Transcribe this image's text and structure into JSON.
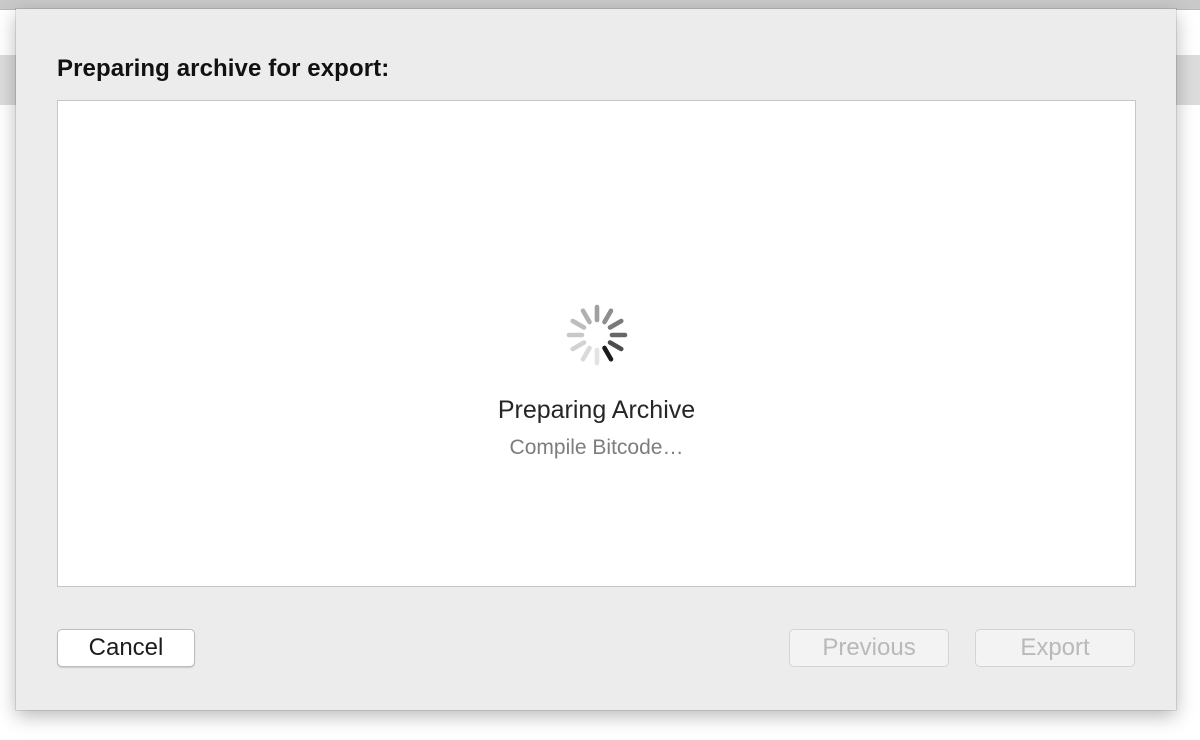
{
  "sheet": {
    "title": "Preparing archive for export:"
  },
  "status": {
    "title": "Preparing Archive",
    "subtitle": "Compile Bitcode…",
    "spinner_icon": "progress-spinner-icon"
  },
  "buttons": {
    "cancel_label": "Cancel",
    "previous_label": "Previous",
    "export_label": "Export"
  }
}
